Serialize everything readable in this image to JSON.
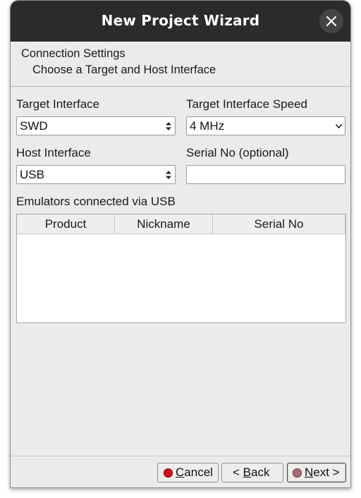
{
  "window": {
    "title": "New Project Wizard"
  },
  "header": {
    "title": "Connection Settings",
    "subtitle": "Choose a Target and Host Interface"
  },
  "form": {
    "target_interface": {
      "label": "Target Interface",
      "value": "SWD"
    },
    "target_interface_speed": {
      "label": "Target Interface Speed",
      "value": "4 MHz"
    },
    "host_interface": {
      "label": "Host Interface",
      "value": "USB"
    },
    "serial_no": {
      "label": "Serial No (optional)",
      "value": ""
    }
  },
  "emulators": {
    "label": "Emulators connected via USB",
    "columns": [
      "Product",
      "Nickname",
      "Serial No"
    ],
    "rows": []
  },
  "buttons": {
    "cancel": {
      "mnemonic": "C",
      "rest": "ancel"
    },
    "back": {
      "prefix": "< ",
      "mnemonic": "B",
      "rest": "ack"
    },
    "next": {
      "mnemonic": "N",
      "rest": "ext >"
    }
  },
  "colors": {
    "titlebar": "#2b2b2b",
    "dialog_bg": "#edebe9",
    "cancel_dot": "#d21414",
    "next_dot": "#a86a78"
  },
  "icons": {
    "close": "close-icon",
    "combo_arrows": "updown-arrows-icon",
    "dropdown_arrow": "chevron-down-icon",
    "cancel": "red-dot-icon",
    "next": "mauve-dot-icon"
  }
}
